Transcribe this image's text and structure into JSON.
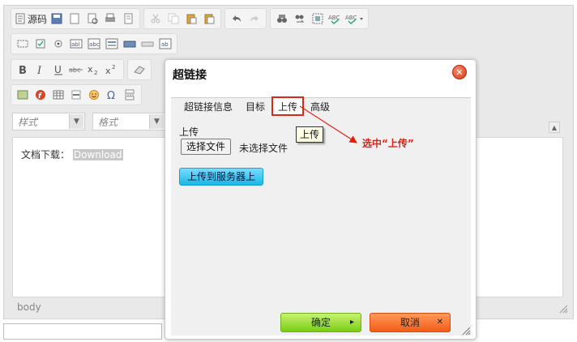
{
  "toolbar": {
    "source_label": "源码"
  },
  "format_combos": {
    "style_placeholder": "样式",
    "format_placeholder": "格式"
  },
  "editor": {
    "content_prefix": "文档下载：",
    "content_link": "Download",
    "status_path": "body"
  },
  "dialog": {
    "title": "超链接",
    "tabs": [
      {
        "label": "超链接信息"
      },
      {
        "label": "目标"
      },
      {
        "label": "上传"
      },
      {
        "label": "高级"
      }
    ],
    "active_tab": "上传",
    "upload_label": "上传",
    "file_button": "选择文件",
    "file_status": "未选择文件",
    "tooltip": "上传",
    "send_button": "上传到服务器上",
    "ok_button": "确定",
    "cancel_button": "取消"
  },
  "annotation": {
    "text": "选中“上传”",
    "color": "#e41e0f"
  },
  "colors": {
    "ok": "#7bcc16",
    "cancel": "#f35c16",
    "send": "#1cb7e8",
    "close": "#d23a12"
  }
}
